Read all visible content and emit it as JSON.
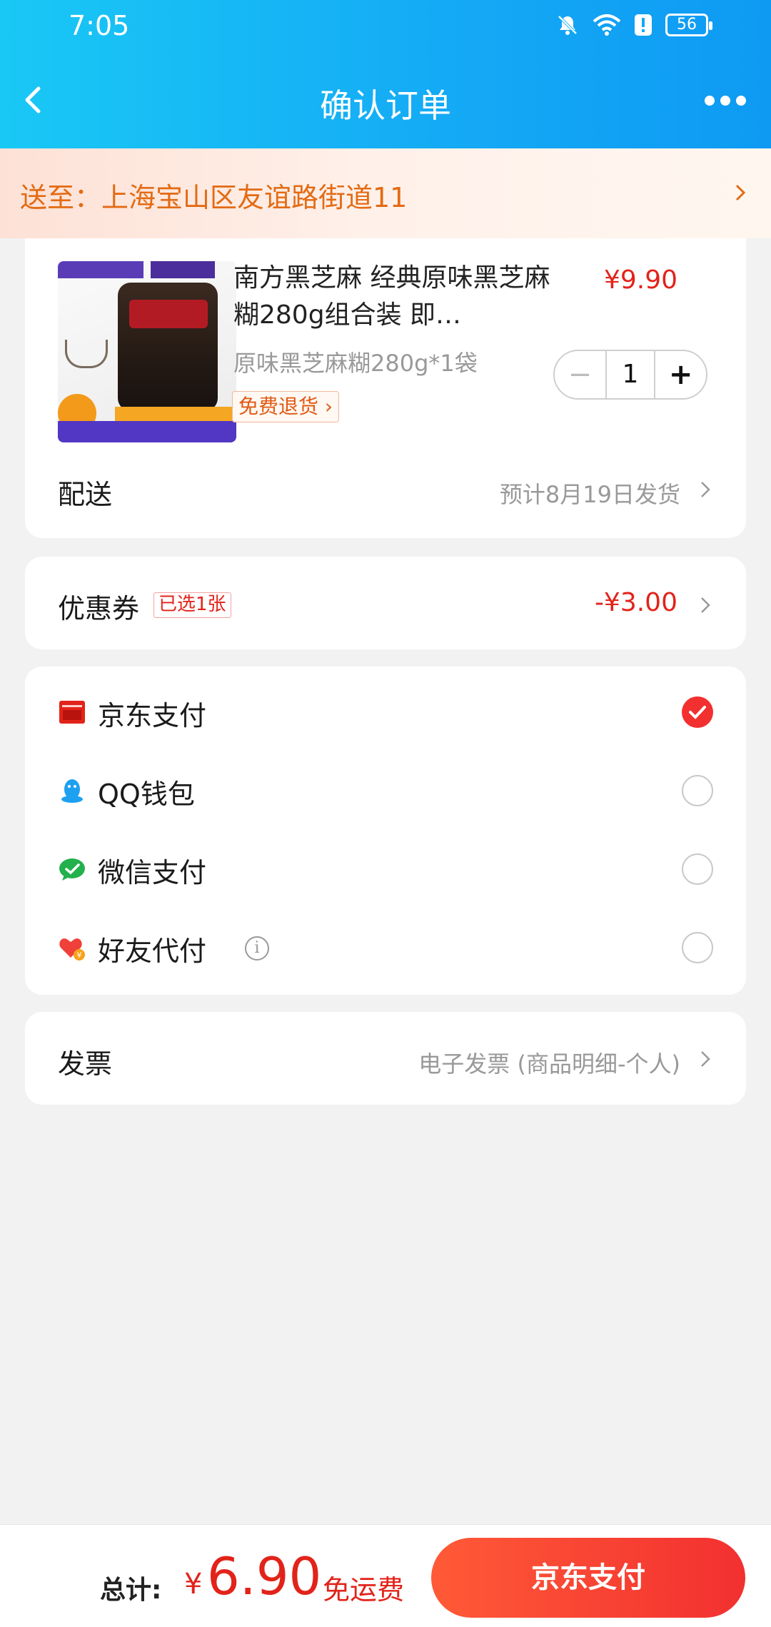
{
  "status_bar": {
    "time": "7:05",
    "battery": "56"
  },
  "header": {
    "title": "确认订单"
  },
  "address": {
    "text": "送至：上海宝山区友谊路街道11"
  },
  "product": {
    "name": "南方黑芝麻 经典原味黑芝麻糊280g组合装 即…",
    "price": "¥9.90",
    "spec": "原味黑芝麻糊280g*1袋",
    "quantity": "1",
    "refund_tag": "免费退货 ›"
  },
  "delivery": {
    "label": "配送",
    "value": "预计8月19日发货"
  },
  "coupon": {
    "label": "优惠券",
    "tag": "已选1张",
    "amount": "-¥3.00"
  },
  "payment_methods": [
    {
      "label": "京东支付",
      "icon": "jd-pay-icon",
      "selected": true
    },
    {
      "label": "QQ钱包",
      "icon": "qq-icon",
      "selected": false
    },
    {
      "label": "微信支付",
      "icon": "wechat-icon",
      "selected": false
    },
    {
      "label": "好友代付",
      "icon": "friend-pay-icon",
      "selected": false
    }
  ],
  "invoice": {
    "label": "发票",
    "value": "电子发票 (商品明细-个人)"
  },
  "footer": {
    "total_label": "总计:",
    "currency": "¥",
    "total_amount": "6.90",
    "shipping": "免运费",
    "pay_button": "京东支付"
  },
  "colors": {
    "accent": "#e2231a",
    "header": "#14a9f5",
    "address_text": "#e36b14"
  }
}
